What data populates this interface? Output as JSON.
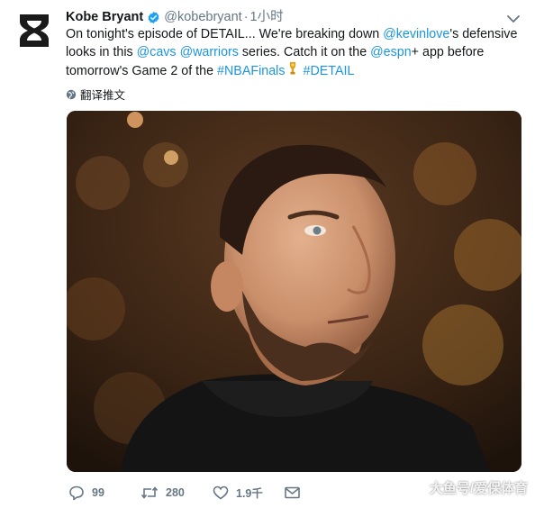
{
  "author": {
    "name": "Kobe Bryant",
    "handle": "@kobebryant",
    "separator": "·",
    "time": "1小时",
    "avatar_icon": "hourglass-logo-icon",
    "verified_icon": "verified-badge-icon"
  },
  "tweet": {
    "segments": [
      {
        "text": "On tonight's episode of DETAIL... We're breaking down ",
        "link": false
      },
      {
        "text": "@kevinlove",
        "link": true
      },
      {
        "text": "'s defensive looks in this ",
        "link": false
      },
      {
        "text": "@cavs",
        "link": true
      },
      {
        "text": " ",
        "link": false
      },
      {
        "text": "@warriors",
        "link": true
      },
      {
        "text": " series.  Catch it on the ",
        "link": false
      },
      {
        "text": "@espn",
        "link": true
      },
      {
        "text": "+ app before tomorrow's Game 2 of the ",
        "link": false
      },
      {
        "text": "#NBAFinals",
        "link": true
      },
      {
        "text": "",
        "link": false,
        "emoji": "trophy-icon"
      },
      {
        "text": " ",
        "link": false
      },
      {
        "text": "#DETAIL",
        "link": true
      }
    ]
  },
  "translate": {
    "label": "翻译推文",
    "icon": "globe-icon"
  },
  "actions": {
    "reply_count": "99",
    "retweet_count": "280",
    "like_count": "1.9千",
    "reply_icon": "reply-icon",
    "retweet_icon": "retweet-icon",
    "like_icon": "heart-icon",
    "dm_icon": "envelope-icon"
  },
  "watermark": "大鱼号/爱保体育",
  "colors": {
    "link": "#1b95e0",
    "secondary_text": "#657786",
    "primary_text": "#14171a",
    "verified": "#1da1f2"
  }
}
